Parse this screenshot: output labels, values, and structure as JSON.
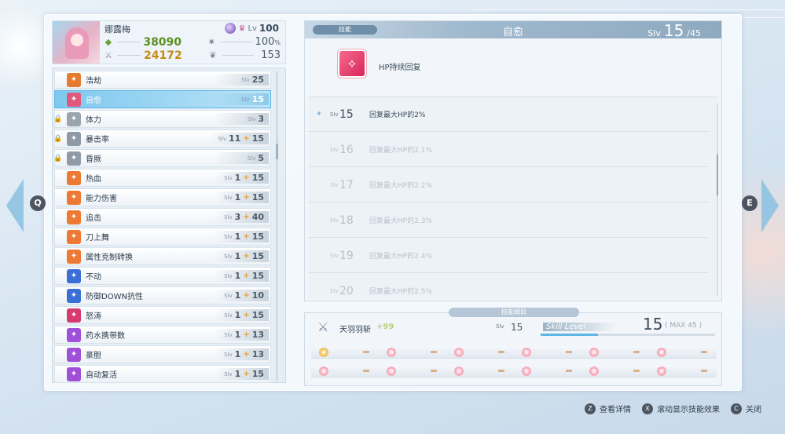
{
  "character": {
    "name": "娜露梅",
    "level_label": "Lv",
    "level": "100",
    "stats": {
      "left_top": "38090",
      "left_bottom": "24172",
      "right_top": "100",
      "right_top_unit": "%",
      "right_bottom": "153"
    },
    "colors": {
      "left_top": "#5a8f1f",
      "left_bottom": "#c68a12"
    }
  },
  "skills": [
    {
      "name": "浩劫",
      "slv_label": "Slv",
      "base": "25",
      "bonus": "",
      "icon": "sword-icon",
      "color": "#e67a2e",
      "locked": false
    },
    {
      "name": "自愈",
      "slv_label": "Slv",
      "base": "15",
      "bonus": "",
      "icon": "sparkle-icon",
      "color": "#e0587a",
      "locked": false,
      "selected": true
    },
    {
      "name": "体力",
      "slv_label": "Slv",
      "base": "3",
      "bonus": "",
      "icon": "heart-icon",
      "color": "#9aa5ae",
      "locked": true
    },
    {
      "name": "暴击率",
      "slv_label": "Slv",
      "base": "11",
      "bonus": "15",
      "icon": "crit-icon",
      "color": "#8e9aa5",
      "locked": true
    },
    {
      "name": "昏厥",
      "slv_label": "Slv",
      "base": "5",
      "bonus": "",
      "icon": "stun-icon",
      "color": "#8e9aa5",
      "locked": true
    },
    {
      "name": "热血",
      "slv_label": "Slv",
      "base": "1",
      "bonus": "15",
      "icon": "flame-icon",
      "color": "#ec7a35",
      "locked": false
    },
    {
      "name": "能力伤害",
      "slv_label": "Slv",
      "base": "1",
      "bonus": "15",
      "icon": "blade-icon",
      "color": "#ec7a35",
      "locked": false
    },
    {
      "name": "追击",
      "slv_label": "Slv",
      "base": "3",
      "bonus": "40",
      "icon": "pursuit-icon",
      "color": "#ec7a35",
      "locked": false
    },
    {
      "name": "刀上舞",
      "slv_label": "Slv",
      "base": "1",
      "bonus": "15",
      "icon": "star-icon",
      "color": "#ec7a35",
      "locked": false
    },
    {
      "name": "属性克制转换",
      "slv_label": "Slv",
      "base": "1",
      "bonus": "15",
      "icon": "star-swap-icon",
      "color": "#ec7a35",
      "locked": false
    },
    {
      "name": "不动",
      "slv_label": "Slv",
      "base": "1",
      "bonus": "15",
      "icon": "shield-orb-icon",
      "color": "#3a6fd8",
      "locked": false
    },
    {
      "name": "防御DOWN抗性",
      "slv_label": "Slv",
      "base": "1",
      "bonus": "10",
      "icon": "defense-icon",
      "color": "#3a6fd8",
      "locked": false
    },
    {
      "name": "怒涛",
      "slv_label": "Slv",
      "base": "1",
      "bonus": "15",
      "icon": "wave-icon",
      "color": "#d83a6f",
      "locked": false
    },
    {
      "name": "药水携带数",
      "slv_label": "Slv",
      "base": "1",
      "bonus": "13",
      "icon": "potion-icon",
      "color": "#a04fd8",
      "locked": false
    },
    {
      "name": "豪胆",
      "slv_label": "Slv",
      "base": "1",
      "bonus": "13",
      "icon": "courage-icon",
      "color": "#a04fd8",
      "locked": false
    },
    {
      "name": "自动复活",
      "slv_label": "Slv",
      "base": "1",
      "bonus": "15",
      "icon": "revive-icon",
      "color": "#a04fd8",
      "locked": false
    }
  ],
  "detail": {
    "tag": "技能",
    "title": "自愈",
    "slv_label": "Slv",
    "slv_current": "15",
    "slv_max": "/45",
    "description": "HP持续回复",
    "levels": [
      {
        "slv_label": "Slv",
        "num": "15",
        "text": "回复最大HP的2%",
        "current": true
      },
      {
        "slv_label": "Slv",
        "num": "16",
        "text": "回复最大HP的2.1%",
        "current": false
      },
      {
        "slv_label": "Slv",
        "num": "17",
        "text": "回复最大HP的2.2%",
        "current": false
      },
      {
        "slv_label": "Slv",
        "num": "18",
        "text": "回复最大HP的2.3%",
        "current": false
      },
      {
        "slv_label": "Slv",
        "num": "19",
        "text": "回复最大HP的2.4%",
        "current": false
      },
      {
        "slv_label": "Slv",
        "num": "20",
        "text": "回复最大HP的2.5%",
        "current": false
      }
    ]
  },
  "weapon": {
    "tab": "技能细目",
    "name": "天羽羽斩",
    "plus": "+99",
    "slv_label": "Slv",
    "slv": "15",
    "skill_level_label": "Skill Level",
    "skill_level": "15",
    "max_label": "( MAX 45 )",
    "skill_level_fraction": 0.33,
    "gems_row1": [
      "star",
      "flower",
      "flower",
      "flower",
      "flower",
      "flower"
    ],
    "gems_row2": [
      "flower",
      "flower",
      "flower",
      "flower",
      "flower",
      "flower"
    ]
  },
  "nav": {
    "left_key": "Q",
    "right_key": "E"
  },
  "footer": [
    {
      "key": "Z",
      "label": "查看详情"
    },
    {
      "key": "X",
      "label": "滚动显示技能效果"
    },
    {
      "key": "C",
      "label": "关闭"
    }
  ]
}
